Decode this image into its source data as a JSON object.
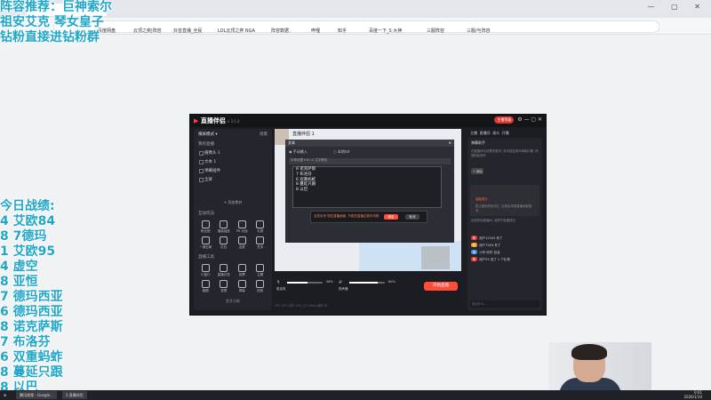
{
  "overlay_top": [
    "阵容推荐：巨神索尔",
    "祖安艾克  琴女皇子",
    "钻粉直接进钻粉群"
  ],
  "overlay_left": {
    "heading": "今日战绩:",
    "lines": [
      "4 艾欧84",
      "8 7德玛",
      "1 艾欧95",
      "4 虚空",
      "8 亚恒",
      "7 德玛西亚",
      "6 德玛西亚",
      "8 诺克萨斯",
      "7 布洛芬",
      "6 双重蚂蚱",
      "8 蔓延只跟",
      "8 以巴"
    ]
  },
  "bookmarks": [
    "百度网盘",
    "云顶之奕|阵容",
    "抖音直播_全民",
    "LOL云顶之弈 NGA",
    "阵容数据",
    "哔哩",
    "知乎",
    "百度一下_S 大神",
    "三服阵容",
    "三服/与阵容"
  ],
  "app": {
    "logo": "直播伴侣",
    "version": "v 3.5.4",
    "title_right_button": "主播等级",
    "left": {
      "scene_label": "横屏模式",
      "scene_sub": "场景",
      "sources_title": "我的直播",
      "sources": [
        "摄像头 1",
        "文本 1",
        "弹幕插件",
        "全屏"
      ],
      "add_source": "+ 添加素材",
      "interact_title": "互动玩法",
      "interact_tools": [
        "粉丝团",
        "福袋抽奖",
        "PK 对战",
        "礼物",
        "一键召唤",
        "红包",
        "连麦",
        "任务"
      ],
      "tools_title": "直播工具",
      "live_tools": [
        "小窗口",
        "直播记录",
        "投票",
        "主题",
        "截图",
        "录屏",
        "弹幕",
        "回放"
      ],
      "more": "更多功能"
    },
    "center": {
      "scene_user": "直播伴侣 1",
      "dialog_title": "文本",
      "radio_manual": "手动输入",
      "radio_file": "本地txt",
      "toolbar_text": "字体设置  ▾  B  I  U  文字颜色",
      "editor_lines": [
        "8 诺克萨斯",
        "7 布洛芬",
        "6 双重蚂蚱",
        "8 蔓延只跟",
        "8 以巴"
      ],
      "toast": "没发出来 现在直播画面, 不能在直播过程中切换",
      "toast_confirm": "确定",
      "toast_cancel": "取消",
      "mic_label": "麦克风",
      "mic_value": "58%",
      "speaker_label": "扬声器",
      "speaker_value": "80%",
      "go_live": "开始直播",
      "status": "CPU 15%   内存 22%   上行 0kb/s   帧率 30"
    },
    "right": {
      "tabs": [
        "主播",
        "直播间",
        "观众",
        "开播"
      ],
      "assistant_title": "弹幕助手",
      "assistant_text": "在直播间中设置关键词, 自动回复观众弹幕问题, 快速回复观众",
      "chip": "+ 添加",
      "alert_label": "温馨提示:",
      "alert_text": "禁止使用低俗词汇, 否则会导致直播间被限流",
      "welcome": "欢迎来到直播间, 请遵守直播规范",
      "danmu": [
        {
          "tag": "粉",
          "color": "#e0352b",
          "text": "用户12345 来了"
        },
        {
          "tag": "粉",
          "color": "#f0902b",
          "text": "用户7284 来了"
        },
        {
          "tag": "新",
          "color": "#3b8be0",
          "text": "小号 你好 加油"
        },
        {
          "tag": "粉",
          "color": "#e0352b",
          "text": "用户55 送了 1 个礼物"
        }
      ],
      "input_placeholder": "说点什么..."
    }
  },
  "taskbar": {
    "items": [
      "腾讯视频 - Google...",
      "S 直播伴侣"
    ],
    "time": "0:01",
    "date": "2026/1/10"
  }
}
